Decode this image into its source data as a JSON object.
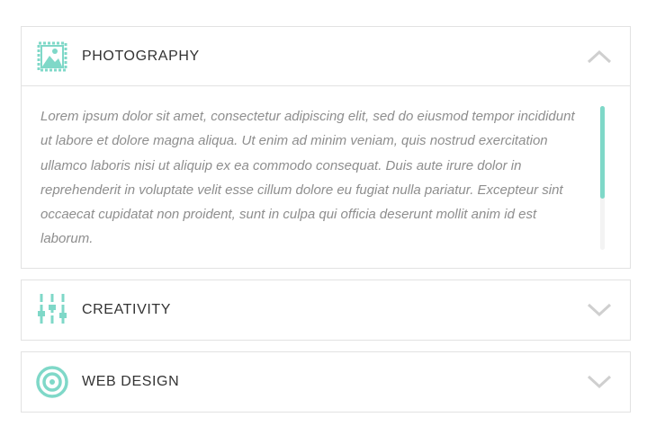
{
  "accent_color": "#7fd8c8",
  "accordion": {
    "panels": [
      {
        "title": "PHOTOGRAPHY",
        "icon": "photo-stamp-icon",
        "state": "expanded",
        "chevron": "chevron-up-icon",
        "content": "Lorem ipsum dolor sit amet, consectetur adipiscing elit, sed do eiusmod tempor incididunt ut labore et dolore magna aliqua. Ut enim ad minim veniam, quis nostrud exercitation ullamco laboris nisi ut aliquip ex ea commodo consequat. Duis aute irure dolor in reprehenderit in voluptate velit esse cillum dolore eu fugiat nulla pariatur. Excepteur sint occaecat cupidatat non proident, sunt in culpa qui officia deserunt mollit anim id est laborum."
      },
      {
        "title": "CREATIVITY",
        "icon": "sliders-icon",
        "state": "collapsed",
        "chevron": "chevron-down-icon"
      },
      {
        "title": "WEB DESIGN",
        "icon": "target-icon",
        "state": "collapsed",
        "chevron": "chevron-down-icon"
      }
    ]
  }
}
